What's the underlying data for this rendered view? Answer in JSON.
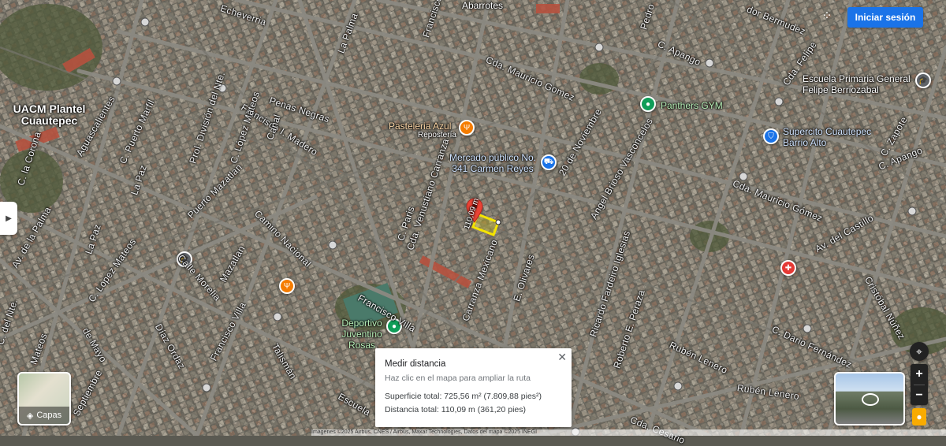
{
  "header": {
    "signin_label": "Iniciar sesión"
  },
  "side_toggle": {
    "icon": "chevron-right-icon"
  },
  "layers": {
    "label": "Capas",
    "icon": "layers-icon"
  },
  "measure": {
    "title": "Medir distancia",
    "hint": "Haz clic en el mapa para ampliar la ruta",
    "area": "Superficie total: 725,56 m² (7.809,88 pies²)",
    "distance": "Distancia total: 110,09 m (361,20 pies)",
    "close_icon": "close-icon"
  },
  "measure_tag": "110,09 m",
  "places": {
    "abarrotes": "Abarrotes",
    "uacm": "UACM Plantel Cuautepec",
    "escuela": "Escuela Primaria General Felipe Berriozabal",
    "panthers": "Panthers GYM",
    "supercito": "Supercito Cuautepec Barrio Alto",
    "pasteleria": "Pasteleria Azul",
    "reposteria": "Repostería",
    "mercado": "Mercado público No. 341 Carmen Reyes",
    "deportivo": "Deportivo Juventino Rosas"
  },
  "streets": {
    "echeverria": "Echeverria",
    "la_palma": "La Palma",
    "francisco": "Francisco",
    "pedro": "Pedro",
    "bermudez": "dor Bermudez",
    "felipe": "Cda. Felipe",
    "mauricio1": "Cda. Mauricio Gomez",
    "apango": "C. Apango",
    "penas": "Penas Negras",
    "madero": "Francisco I. Madero",
    "division": "Prol. División del Nte.",
    "lopez_m": "C. López Mateos",
    "canal": "Canal",
    "aguascalientes": "Aguascalientes",
    "puerto_marfil": "C. Puerto Marfil",
    "corona": "C. la Corona",
    "la_paz": "La Paz",
    "la_paz2": "La Paz",
    "camino": "Camino Nacional",
    "puerto_mazatlan": "Puerto Mazatlan",
    "paris": "C. Paris",
    "carranza": "Cda. Venustiano Carranza",
    "nov": "20 de Noviembre",
    "vasconcelos": "Angel Brioso Vasconcelos",
    "mauricio2": "Cda. Mauricio Gómez",
    "zapote": "C. Zapote",
    "apango2": "C. Apango",
    "castillo": "Av. del Castillo",
    "nunez": "Cristóbal Núñez",
    "palma2": "Av. de la Palma",
    "morelia": "Calle Morelia",
    "mazatlan": "Mazatlan",
    "lopez2": "C. Lopez Mateos",
    "mayo": "de Mayo",
    "diaz": "Díaz Ordaz",
    "fvilla": "Francisco Villa",
    "fvilla2": "Francisco Villa",
    "talisman": "Talismán",
    "mexicano": "Carranza Mexicano",
    "olivares": "E. Olivares",
    "iglesias": "Ricardo Fardeiro Iglesias",
    "peraza": "Roberto E. Peraza",
    "lenero": "Rubén Lenero",
    "lenero2": "Rubén Lenero",
    "fernandez": "C. Dario Fernández",
    "mateos3": "Mateos",
    "nte": "C. del Nte.",
    "septiembre": "Septiembre",
    "cda_cesario": "Cda. Cesario",
    "escuela_st": "Escuela"
  },
  "footer": "Imágenes ©2025 Airbus, CNES / Airbus, Maxar Technologies, Datos del mapa ©2025 INEGI",
  "colors": {
    "accent": "#1a73e8",
    "measure_line": "#f5e400",
    "pin": "#ea4335",
    "green_poi": "#0f9d58",
    "orange_poi": "#f57c00",
    "blue_poi": "#1a73e8",
    "red_poi": "#e53935"
  }
}
